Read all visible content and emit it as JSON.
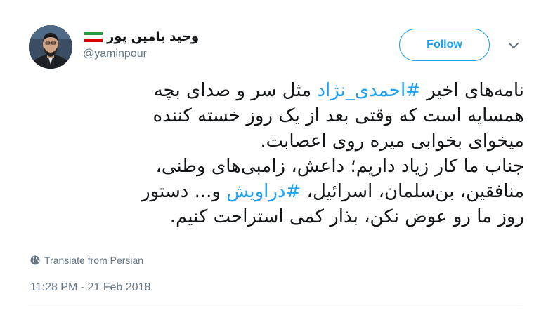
{
  "tweet": {
    "author": {
      "display_name": "وحید یامین پور",
      "handle": "@yaminpour",
      "avatar_icon": "profile-photo",
      "flag_icon": "iran-flag"
    },
    "follow_label": "Follow",
    "menu_icon": "chevron-down-icon",
    "lines": [
      {
        "pre": "نامه‌های اخیر ",
        "tag": "#احمدی_نژاد",
        "post": " مثل سر و صدای بچه"
      },
      {
        "pre": "همسایه است که وقتی بعد از یک روز خسته کننده",
        "tag": "",
        "post": ""
      },
      {
        "pre": "میخوای بخوابی میره روی اعصابت.",
        "tag": "",
        "post": ""
      },
      {
        "pre": "جناب ما کار زیاد داریم؛ داعش، زامبی‌های وطنی،",
        "tag": "",
        "post": ""
      },
      {
        "pre": "منافقین، بن‌سلمان، اسرائیل، ",
        "tag": "#دراویش",
        "post": " و... دستور"
      },
      {
        "pre": "روز ما رو عوض نکن، بذار کمی استراحت کنیم.",
        "tag": "",
        "post": ""
      }
    ],
    "translate_label": "Translate from Persian",
    "timestamp": "11:28 PM - 21 Feb 2018"
  },
  "colors": {
    "accent": "#1da1f2",
    "text": "#14171a",
    "muted": "#657786",
    "divider": "#e6ecf0"
  }
}
